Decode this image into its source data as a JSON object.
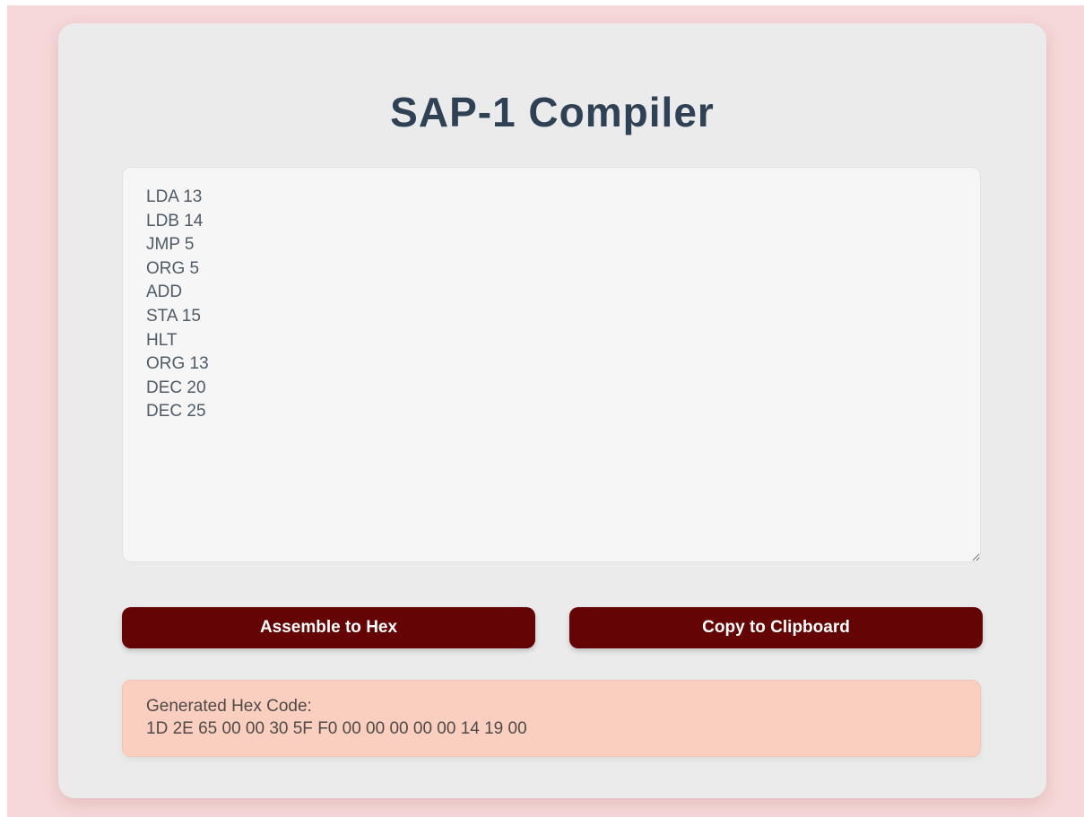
{
  "header": {
    "title": "SAP-1 Compiler"
  },
  "editor": {
    "value": "LDA 13\nLDB 14\nJMP 5\nORG 5\nADD\nSTA 15\nHLT\nORG 13\nDEC 20\nDEC 25"
  },
  "actions": {
    "assemble_label": "Assemble to Hex",
    "copy_label": "Copy to Clipboard"
  },
  "output": {
    "label": "Generated Hex Code:",
    "hex": "1D 2E 65 00 00 30 5F F0 00 00 00 00 00 14 19 00"
  },
  "colors": {
    "page_background": "#f6d8d8",
    "card_background": "#ebebeb",
    "title": "#2e4155",
    "button": "#640404",
    "output_background": "#facfc0"
  }
}
